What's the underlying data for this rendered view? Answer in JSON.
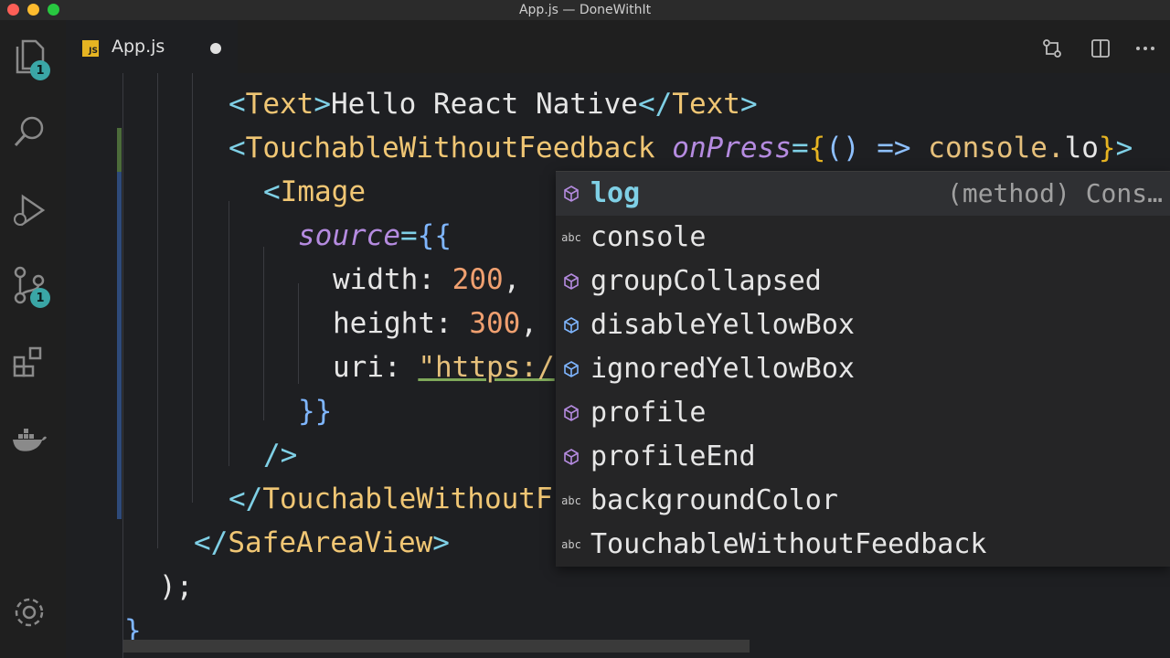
{
  "window": {
    "title": "App.js — DoneWithIt"
  },
  "activity_bar": {
    "explorer_badge": "1",
    "source_control_badge": "1"
  },
  "tabs": [
    {
      "label": "App.js",
      "icon_text": "JS"
    }
  ],
  "code": {
    "line1": {
      "open": "<",
      "tag": "Text",
      "close": ">",
      "text": "Hello React Native",
      "end_open": "</",
      "end_tag": "Text",
      "end_close": ">"
    },
    "line2": {
      "open": "<",
      "tag": "TouchableWithoutFeedback",
      "attr": "onPress",
      "eq": "=",
      "brace_open": "{",
      "arrow": "() =>",
      "call": "console.",
      "typed": "lo",
      "brace_close": "}",
      "close": ">"
    },
    "line3": {
      "open": "<",
      "tag": "Image"
    },
    "line4": {
      "attr": "source",
      "eq": "=",
      "braces": "{{"
    },
    "line5": {
      "key": "width",
      "colon": ":",
      "value": "200",
      "comma": ","
    },
    "line6": {
      "key": "height",
      "colon": ":",
      "value": "300",
      "comma": ","
    },
    "line7": {
      "key": "uri",
      "colon": ":",
      "value": "\"https:/"
    },
    "line8": {
      "braces": "}}"
    },
    "line9": {
      "close": "/>"
    },
    "line10": {
      "open": "</",
      "tag": "TouchableWithoutF"
    },
    "line11": {
      "open": "</",
      "tag": "SafeAreaView",
      "close": ">"
    },
    "line12": {
      "text": ");"
    },
    "line13": {
      "text": "}"
    }
  },
  "suggestions": [
    {
      "label": "log",
      "kind": "method",
      "detail": "(method) Cons…"
    },
    {
      "label": "console",
      "kind": "text"
    },
    {
      "label": "groupCollapsed",
      "kind": "method"
    },
    {
      "label": "disableYellowBox",
      "kind": "property"
    },
    {
      "label": "ignoredYellowBox",
      "kind": "property"
    },
    {
      "label": "profile",
      "kind": "method"
    },
    {
      "label": "profileEnd",
      "kind": "method"
    },
    {
      "label": "backgroundColor",
      "kind": "text"
    },
    {
      "label": "TouchableWithoutFeedback",
      "kind": "text"
    }
  ],
  "suggest_icon_abc": "abc",
  "colors": {
    "accent": "#3aa6a6",
    "background": "#1e1f22",
    "tag": "#f0c674",
    "bracket": "#7fd0e6",
    "attribute": "#b58be0",
    "number": "#f0a070"
  }
}
